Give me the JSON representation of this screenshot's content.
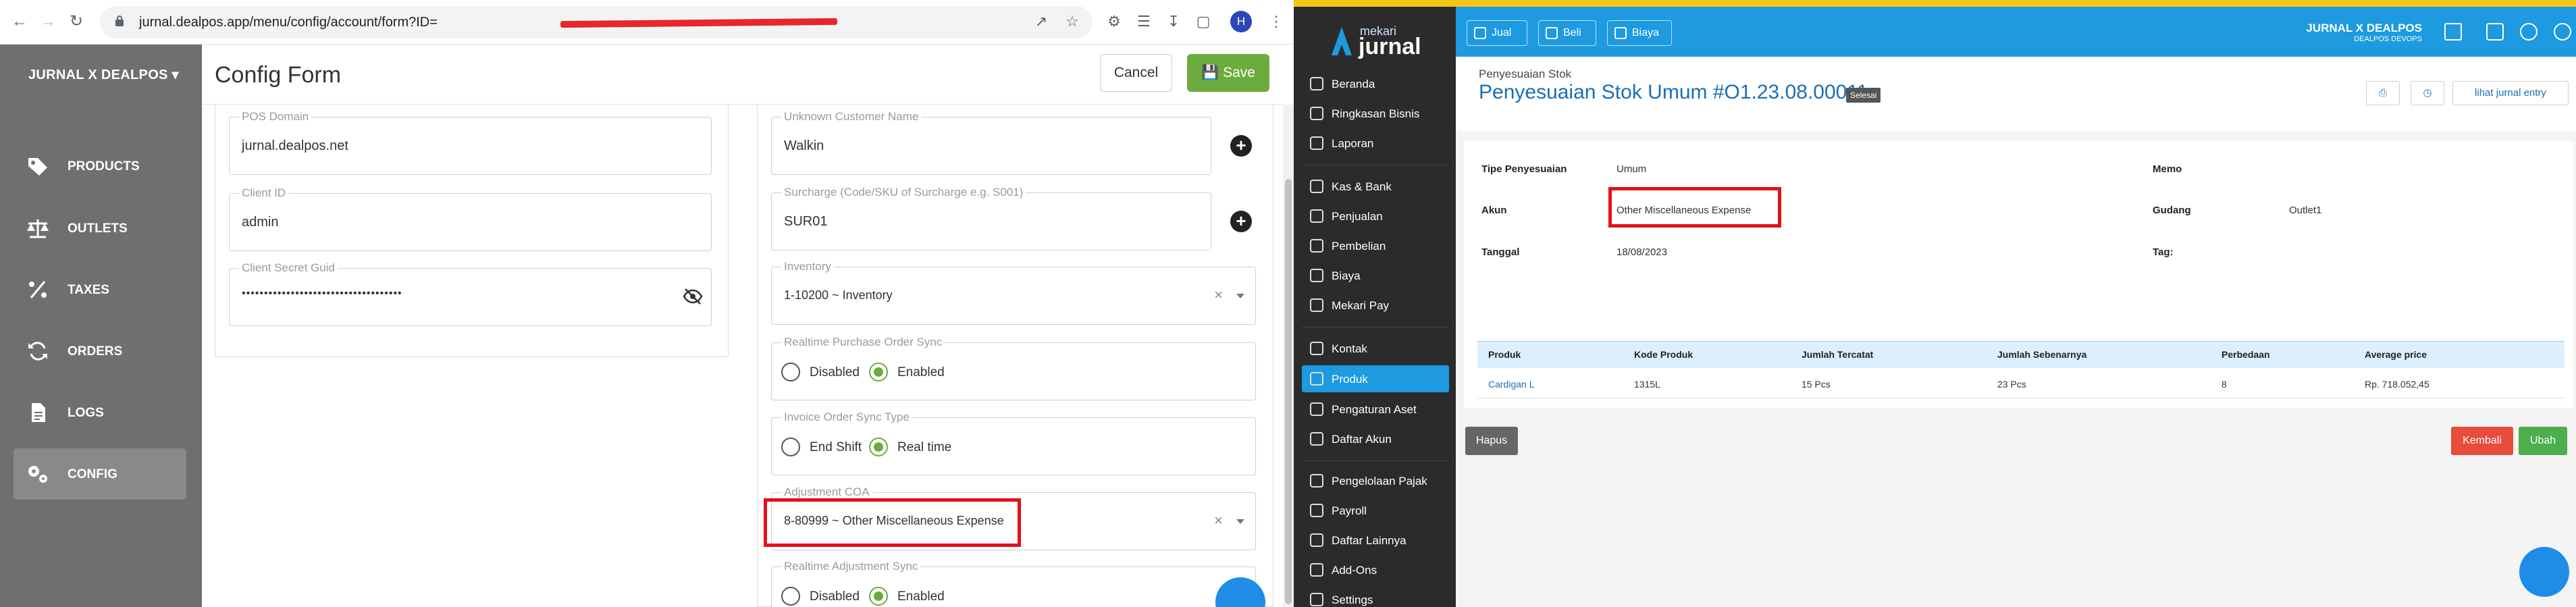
{
  "browser": {
    "url": "jurnal.dealpos.app/menu/config/account/form?ID=",
    "profile_initial": "H"
  },
  "dealpos": {
    "brand": "JURNAL X DEALPOS",
    "nav": [
      {
        "label": "PRODUCTS",
        "icon": "tag-icon"
      },
      {
        "label": "OUTLETS",
        "icon": "scale-icon"
      },
      {
        "label": "TAXES",
        "icon": "percent-icon"
      },
      {
        "label": "ORDERS",
        "icon": "sync-icon"
      },
      {
        "label": "LOGS",
        "icon": "document-icon"
      },
      {
        "label": "CONFIG",
        "icon": "gears-icon",
        "active": true
      }
    ],
    "page_title": "Config Form",
    "cancel_label": "Cancel",
    "save_label": "Save",
    "left_fields": {
      "pos_domain": {
        "label": "POS Domain",
        "value": "jurnal.dealpos.net"
      },
      "client_id": {
        "label": "Client ID",
        "value": "admin"
      },
      "client_secret": {
        "label": "Client Secret Guid",
        "value": "••••••••••••••••••••••••••••••••••••"
      }
    },
    "right_fields": {
      "unknown_customer": {
        "label": "Unknown Customer Name",
        "value": "Walkin"
      },
      "surcharge": {
        "label": "Surcharge (Code/SKU of Surcharge e.g. S001)",
        "value": "SUR01"
      },
      "inventory": {
        "label": "Inventory",
        "value": "1-10200 ~ Inventory"
      },
      "realtime_po": {
        "label": "Realtime Purchase Order Sync",
        "options": [
          "Disabled",
          "Enabled"
        ],
        "selected": "Enabled"
      },
      "invoice_sync": {
        "label": "Invoice Order Sync Type",
        "options": [
          "End Shift",
          "Real time"
        ],
        "selected": "Real time"
      },
      "adjustment_coa": {
        "label": "Adjustment COA",
        "value": "8-80999 ~ Other Miscellaneous Expense"
      },
      "realtime_adj": {
        "label": "Realtime Adjustment Sync",
        "options": [
          "Disabled",
          "Enabled"
        ],
        "selected": "Enabled"
      }
    }
  },
  "jurnal": {
    "logo_top": "mekari",
    "logo_main": "jurnal",
    "nav_group1": [
      "Beranda",
      "Ringkasan Bisnis",
      "Laporan"
    ],
    "nav_group2": [
      "Kas & Bank",
      "Penjualan",
      "Pembelian",
      "Biaya",
      "Mekari Pay"
    ],
    "nav_group3": [
      "Kontak",
      "Produk",
      "Pengaturan Aset",
      "Daftar Akun"
    ],
    "nav_group4": [
      "Pengelolaan Pajak",
      "Payroll",
      "Daftar Lainnya",
      "Add-Ons",
      "Settings"
    ],
    "active_nav": "Produk",
    "topbar_buttons": [
      "Jual",
      "Beli",
      "Biaya"
    ],
    "company_name": "JURNAL X DEALPOS",
    "company_sub": "DEALPOS DEVOPS",
    "breadcrumb": "Penyesuaian Stok",
    "title": "Penyesuaian Stok Umum #O1.23.08.00011",
    "status_badge": "Selesai",
    "journal_link": "lihat jurnal entry",
    "fields": {
      "tipe_label": "Tipe Penyesuaian",
      "tipe_value": "Umum",
      "akun_label": "Akun",
      "akun_value": "Other Miscellaneous Expense",
      "tanggal_label": "Tanggal",
      "tanggal_value": "18/08/2023",
      "memo_label": "Memo",
      "gudang_label": "Gudang",
      "gudang_value": "Outlet1",
      "tag_label": "Tag:"
    },
    "table": {
      "headers": [
        "Produk",
        "Kode Produk",
        "Jumlah Tercatat",
        "Jumlah Sebenarnya",
        "Perbedaan",
        "Average price"
      ],
      "row": [
        "Cardigan L",
        "1315L",
        "15 Pcs",
        "23 Pcs",
        "8",
        "Rp. 718.052,45"
      ]
    },
    "delete_label": "Hapus",
    "back_label": "Kembali",
    "edit_label": "Ubah",
    "colors": {
      "primary": "#1d9ae0",
      "sidebar": "#2b2b2b",
      "back": "#e74c3c",
      "edit": "#4cae4c",
      "highlight": "#e3111b"
    }
  }
}
